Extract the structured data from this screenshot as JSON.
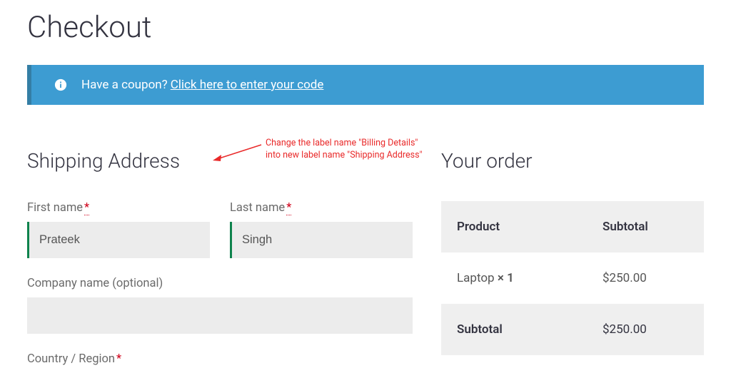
{
  "page_title": "Checkout",
  "coupon": {
    "question": "Have a coupon?",
    "link_text": "Click here to enter your code"
  },
  "billing": {
    "heading": "Shipping Address",
    "first_name_label": "First name",
    "first_name_value": "Prateek",
    "last_name_label": "Last name",
    "last_name_value": "Singh",
    "company_label": "Company name (optional)",
    "company_value": "",
    "country_label": "Country / Region"
  },
  "annotation": {
    "line1": "Change the label name \"Billing Details\"",
    "line2": "into new label name \"Shipping Address\""
  },
  "order": {
    "heading": "Your order",
    "header_product": "Product",
    "header_subtotal": "Subtotal",
    "item_name": "Laptop",
    "item_qty": "× 1",
    "item_price": "$250.00",
    "subtotal_label": "Subtotal",
    "subtotal_value": "$250.00"
  },
  "required_mark": "*"
}
